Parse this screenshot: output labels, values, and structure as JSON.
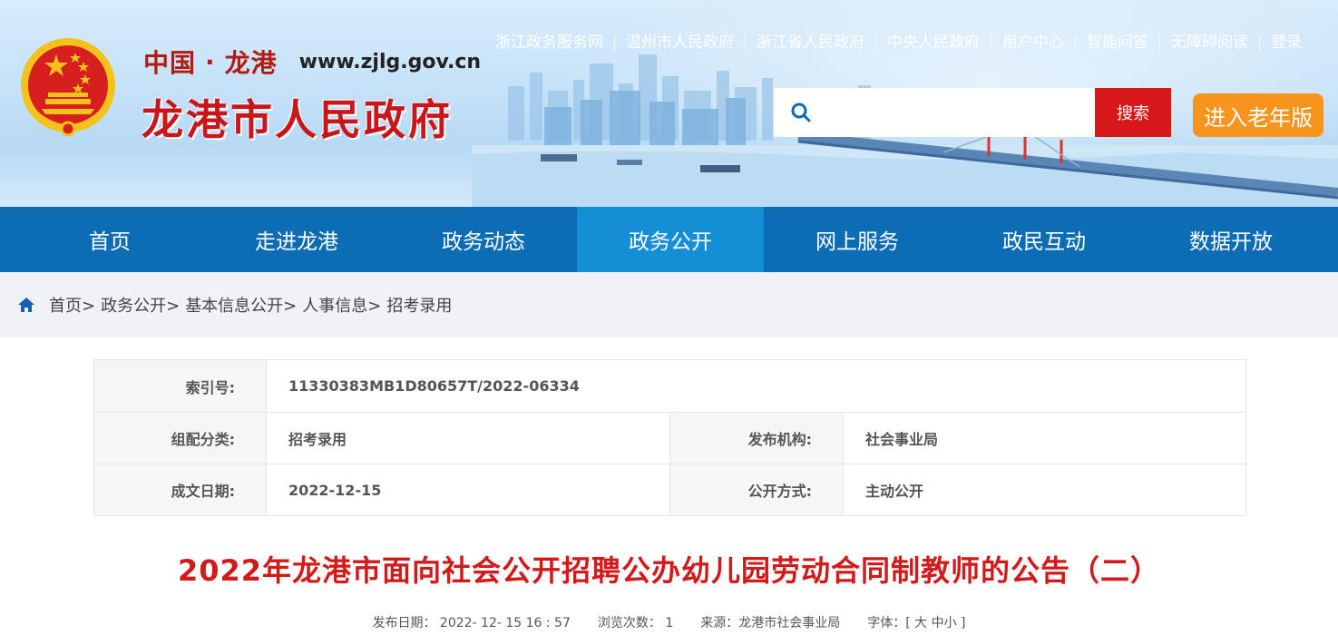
{
  "header": {
    "brand_prefix": "中国",
    "brand_dot": "·",
    "brand_city": "龙港",
    "brand_url": "www.zjlg.gov.cn",
    "site_title": "龙港市人民政府",
    "top_links": [
      "浙江政务服务网",
      "温州市人民政府",
      "浙江省人民政府",
      "中央人民政府",
      "用户中心",
      "智能问答",
      "无障碍阅读",
      "登录"
    ],
    "search_placeholder": "",
    "search_button": "搜索",
    "elder_button": "进入老年版"
  },
  "nav": {
    "items": [
      "首页",
      "走进龙港",
      "政务动态",
      "政务公开",
      "网上服务",
      "政民互动",
      "数据开放"
    ],
    "active": "政务公开"
  },
  "breadcrumb": {
    "home": "首页>",
    "items": [
      "政务公开>",
      "基本信息公开>",
      "人事信息>",
      "招考录用"
    ]
  },
  "info": {
    "index_label": "索引号:",
    "index_value": "11330383MB1D80657T/2022-06334",
    "category_label": "组配分类:",
    "category_value": "招考录用",
    "publisher_label": "发布机构:",
    "publisher_value": "社会事业局",
    "date_label": "成文日期:",
    "date_value": "2022-12-15",
    "mode_label": "公开方式:",
    "mode_value": "主动公开"
  },
  "article": {
    "title": "2022年龙港市面向社会公开招聘公办幼儿园劳动合同制教师的公告（二）",
    "meta_date": "发布日期：  2022- 12- 15 16 : 57",
    "meta_views": "浏览次数：  1",
    "meta_source": "来源：龙港市社会事业局",
    "meta_font": "字体：[ 大 中小 ]"
  },
  "colors": {
    "brand_red": "#c8171b",
    "nav_blue": "#0c6cb4",
    "nav_active": "#148fd6",
    "search_red": "#d71718",
    "elder_orange": "#f7941d"
  }
}
